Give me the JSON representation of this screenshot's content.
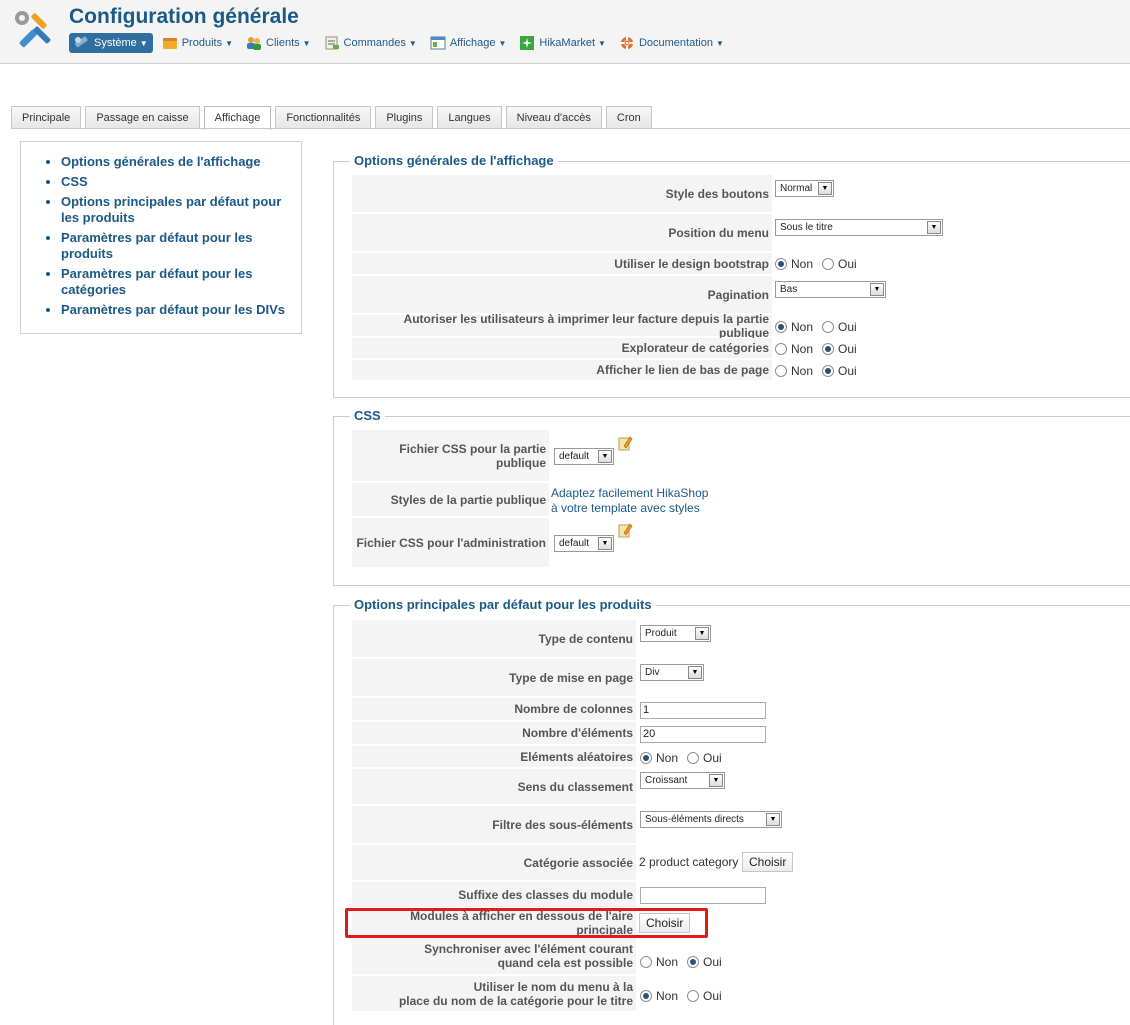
{
  "header": {
    "title": "Configuration générale",
    "menu": [
      {
        "label": "Système",
        "icon": "system-icon",
        "active": true
      },
      {
        "label": "Produits",
        "icon": "products-icon"
      },
      {
        "label": "Clients",
        "icon": "clients-icon"
      },
      {
        "label": "Commandes",
        "icon": "orders-icon"
      },
      {
        "label": "Affichage",
        "icon": "display-icon"
      },
      {
        "label": "HikaMarket",
        "icon": "hikamarket-icon"
      },
      {
        "label": "Documentation",
        "icon": "help-icon"
      }
    ]
  },
  "tabs": [
    "Principale",
    "Passage en caisse",
    "Affichage",
    "Fonctionnalités",
    "Plugins",
    "Langues",
    "Niveau d'accès",
    "Cron"
  ],
  "active_tab": "Affichage",
  "nav": [
    "Options générales de l'affichage",
    "CSS",
    "Options principales par défaut pour les produits",
    "Paramètres par défaut pour les produits",
    "Paramètres par défaut pour les catégories",
    "Paramètres par défaut pour les DIVs"
  ],
  "general": {
    "legend": "Options générales de l'affichage",
    "button_style": {
      "label": "Style des boutons",
      "value": "Normal"
    },
    "menu_position": {
      "label": "Position du menu",
      "value": "Sous le titre"
    },
    "bootstrap": {
      "label": "Utiliser le design bootstrap",
      "no": "Non",
      "yes": "Oui",
      "selected": "no"
    },
    "pagination": {
      "label": "Pagination",
      "value": "Bas"
    },
    "print_invoice": {
      "label": "Autoriser les utilisateurs à imprimer leur facture depuis la partie publique",
      "no": "Non",
      "yes": "Oui",
      "selected": "no"
    },
    "category_explorer": {
      "label": "Explorateur de catégories",
      "no": "Non",
      "yes": "Oui",
      "selected": "yes"
    },
    "footer_link": {
      "label": "Afficher le lien de bas de page",
      "no": "Non",
      "yes": "Oui",
      "selected": "yes"
    }
  },
  "css": {
    "legend": "CSS",
    "front_css": {
      "label": "Fichier CSS pour la partie publique",
      "value": "default"
    },
    "front_styles": {
      "label": "Styles de la partie publique",
      "link_line1": "Adaptez facilement HikaShop",
      "link_line2": "à votre template avec styles"
    },
    "admin_css": {
      "label": "Fichier CSS pour l'administration",
      "value": "default"
    }
  },
  "products": {
    "legend": "Options principales par défaut pour les produits",
    "content_type": {
      "label": "Type de contenu",
      "value": "Produit"
    },
    "layout_type": {
      "label": "Type de mise en page",
      "value": "Div"
    },
    "columns": {
      "label": "Nombre de colonnes",
      "value": "1"
    },
    "elements": {
      "label": "Nombre d'éléments",
      "value": "20"
    },
    "random": {
      "label": "Eléments aléatoires",
      "no": "Non",
      "yes": "Oui",
      "selected": "no"
    },
    "sort_order": {
      "label": "Sens du classement",
      "value": "Croissant"
    },
    "sub_filter": {
      "label": "Filtre des sous-éléments",
      "value": "Sous-éléments directs"
    },
    "category": {
      "label": "Catégorie associée",
      "value": "2 product category",
      "button": "Choisir"
    },
    "suffix": {
      "label": "Suffixe des classes du module",
      "value": ""
    },
    "modules": {
      "label": "Modules à afficher en dessous de l'aire principale",
      "button": "Choisir"
    },
    "sync": {
      "label_line1": "Synchroniser avec l'élément courant",
      "label_line2": "quand cela est possible",
      "no": "Non",
      "yes": "Oui",
      "selected": "yes"
    },
    "menu_name": {
      "label_line1": "Utiliser le nom du menu à la",
      "label_line2": "place du nom de la catégorie pour le titre",
      "no": "Non",
      "yes": "Oui",
      "selected": "no"
    }
  }
}
